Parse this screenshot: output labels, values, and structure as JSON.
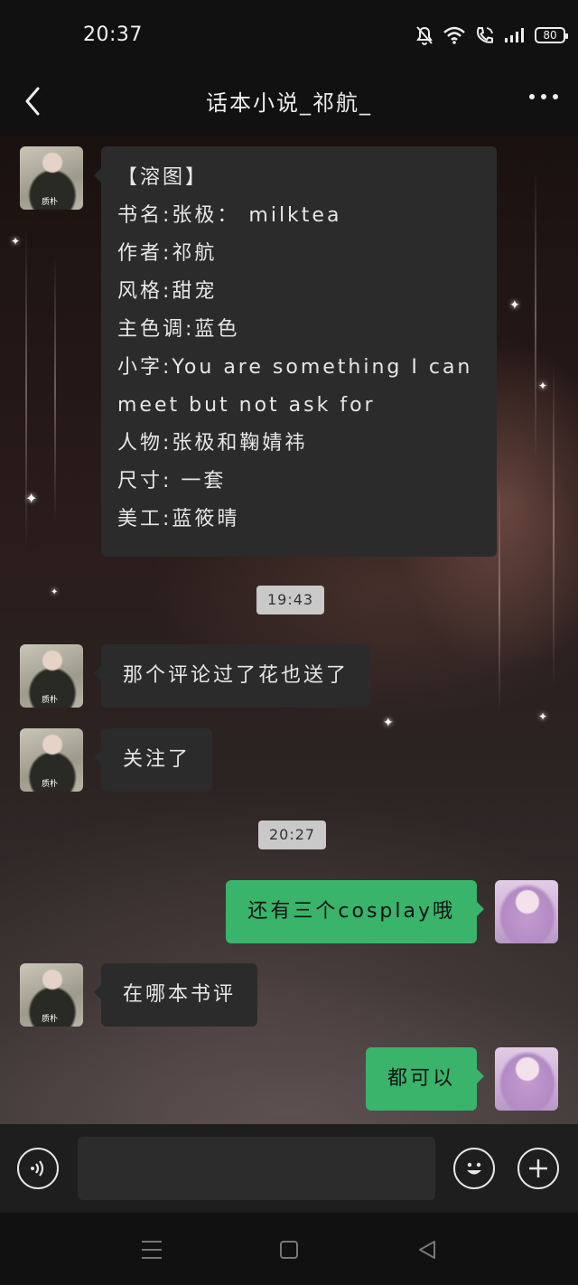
{
  "status": {
    "time": "20:37",
    "battery": "80",
    "icons": [
      "mute-icon",
      "wifi-icon",
      "call-icon",
      "signal-icon",
      "battery-icon"
    ]
  },
  "header": {
    "title": "话本小说_祁航_",
    "back_icon": "back-chevron-icon",
    "more_icon": "more-dots-icon"
  },
  "messages": [
    {
      "side": "in",
      "avatar_label": "质朴",
      "lines": [
        "【溶图】",
        "书名:张极： milktea",
        "作者:祁航",
        "风格:甜宠",
        "主色调:蓝色",
        "小字:You are something I can",
        "meet but not ask for",
        "人物:张极和鞠婧祎",
        "尺寸: 一套",
        "美工:蓝筱晴"
      ]
    },
    {
      "type": "time",
      "text": "19:43"
    },
    {
      "side": "in",
      "avatar_label": "质朴",
      "text": "那个评论过了花也送了"
    },
    {
      "side": "in",
      "avatar_label": "质朴",
      "text": "关注了"
    },
    {
      "type": "time",
      "text": "20:27"
    },
    {
      "side": "out",
      "text": "还有三个cosplay哦"
    },
    {
      "side": "in",
      "avatar_label": "质朴",
      "text": "在哪本书评"
    },
    {
      "side": "out",
      "text": "都可以"
    }
  ],
  "input_bar": {
    "voice_icon": "voice-icon",
    "text_value": "",
    "emoji_icon": "emoji-icon",
    "plus_icon": "plus-icon"
  },
  "system_nav": {
    "icons": [
      "menu-icon",
      "home-icon",
      "back-triangle-icon"
    ]
  }
}
